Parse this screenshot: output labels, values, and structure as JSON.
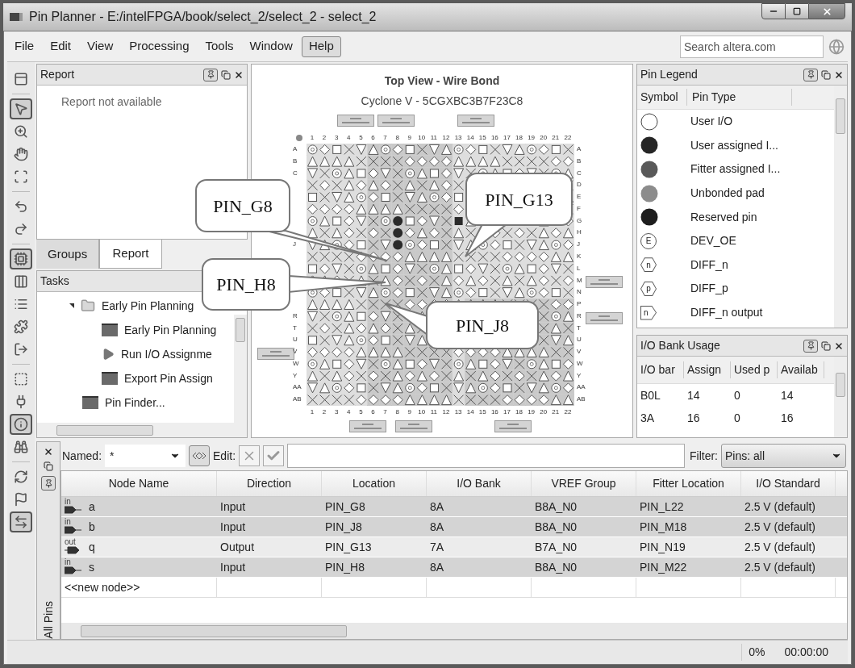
{
  "window": {
    "title": "Pin Planner - E:/intelFPGA/book/select_2/select_2 - select_2"
  },
  "menu": [
    {
      "label": "File",
      "selected": false
    },
    {
      "label": "Edit",
      "selected": false
    },
    {
      "label": "View",
      "selected": false
    },
    {
      "label": "Processing",
      "selected": false
    },
    {
      "label": "Tools",
      "selected": false
    },
    {
      "label": "Window",
      "selected": false
    },
    {
      "label": "Help",
      "selected": true
    }
  ],
  "search": {
    "placeholder": "Search altera.com"
  },
  "left_toolbar": [
    {
      "kind": "layout",
      "selected": false
    },
    {
      "kind": "separator"
    },
    {
      "kind": "pointer",
      "selected": true
    },
    {
      "kind": "zoom",
      "selected": false
    },
    {
      "kind": "hand",
      "selected": false
    },
    {
      "kind": "fit",
      "selected": false
    },
    {
      "kind": "separator"
    },
    {
      "kind": "undo",
      "selected": false
    },
    {
      "kind": "redo",
      "selected": false
    },
    {
      "kind": "separator"
    },
    {
      "kind": "chip",
      "selected": true
    },
    {
      "kind": "columns",
      "selected": false
    },
    {
      "kind": "list",
      "selected": false
    },
    {
      "kind": "puzzle",
      "selected": false
    },
    {
      "kind": "export",
      "selected": false
    },
    {
      "kind": "separator"
    },
    {
      "kind": "dashed",
      "selected": false
    },
    {
      "kind": "plug",
      "selected": false
    },
    {
      "kind": "info",
      "selected": true
    },
    {
      "kind": "binoculars",
      "selected": false
    },
    {
      "kind": "separator"
    },
    {
      "kind": "refresh",
      "selected": false
    },
    {
      "kind": "flag",
      "selected": false
    },
    {
      "kind": "swap",
      "selected": true
    }
  ],
  "report_panel": {
    "title": "Report",
    "message": "Report not available"
  },
  "left_tabs": [
    {
      "label": "Groups",
      "selected": false
    },
    {
      "label": "Report",
      "selected": true
    }
  ],
  "tasks_panel": {
    "title": "Tasks",
    "items": [
      {
        "label": "Early Pin Planning",
        "kind": "folder",
        "expanded": true,
        "children": [
          {
            "label": "Early Pin Planning",
            "kind": "task"
          },
          {
            "label": "Run I/O Assignme",
            "kind": "run"
          },
          {
            "label": "Export Pin Assign",
            "kind": "task"
          }
        ]
      },
      {
        "label": "Pin Finder...",
        "kind": "task"
      }
    ]
  },
  "package_view": {
    "title": "Top View - Wire Bond",
    "subtitle": "Cyclone V - 5CGXBC3B7F23C8",
    "top_column_labels": [
      "1",
      "2",
      "3",
      "4",
      "5",
      "6",
      "7",
      "8",
      "9",
      "10",
      "11",
      "12",
      "13",
      "14",
      "15",
      "16",
      "17",
      "18",
      "19",
      "20",
      "21",
      "22"
    ],
    "bottom_column_labels": [
      "1",
      "2",
      "3",
      "4",
      "5",
      "6",
      "7",
      "8",
      "9",
      "10",
      "11",
      "12",
      "13",
      "14",
      "15",
      "16",
      "17",
      "18",
      "19",
      "20",
      "21",
      "22"
    ],
    "left_row_labels": [
      "A",
      "B",
      "C",
      "J",
      "R",
      "T",
      "U",
      "V",
      "W",
      "Y",
      "AA",
      "AB"
    ],
    "right_row_labels": [
      "A",
      "B",
      "C",
      "D",
      "E",
      "F",
      "G",
      "H",
      "J",
      "K",
      "L",
      "M",
      "N",
      "P",
      "R",
      "T",
      "U",
      "V",
      "W",
      "Y",
      "AA",
      "AB"
    ],
    "callouts": [
      {
        "label": "PIN_G8"
      },
      {
        "label": "PIN_G13"
      },
      {
        "label": "PIN_H8"
      },
      {
        "label": "PIN_J8"
      }
    ]
  },
  "pin_legend": {
    "title": "Pin Legend",
    "columns": [
      "Symbol",
      "Pin Type"
    ],
    "rows": [
      {
        "kind": "hollow",
        "label": "User I/O"
      },
      {
        "kind": "filled",
        "color": "#262626",
        "label": "User assigned I..."
      },
      {
        "kind": "filled",
        "color": "#595959",
        "label": "Fitter assigned I..."
      },
      {
        "kind": "filled",
        "color": "#8c8c8c",
        "label": "Unbonded pad"
      },
      {
        "kind": "filled",
        "color": "#1e1e1e",
        "label": "Reserved pin"
      },
      {
        "kind": "circle",
        "glyph": "E",
        "label": "DEV_OE"
      },
      {
        "kind": "hexagon",
        "glyph": "n",
        "label": "DIFF_n"
      },
      {
        "kind": "hexagon",
        "glyph": "p",
        "label": "DIFF_p"
      },
      {
        "kind": "pentagon",
        "glyph": "n",
        "label": "DIFF_n output"
      }
    ]
  },
  "bank_usage": {
    "title": "I/O Bank Usage",
    "columns": [
      "I/O bar",
      "Assign",
      "Used p",
      "Availab"
    ],
    "rows": [
      [
        "B0L",
        "14",
        "0",
        "14"
      ],
      [
        "3A",
        "16",
        "0",
        "16"
      ]
    ]
  },
  "node_filter": {
    "named_label": "Named:",
    "named_value": "*",
    "edit_label": "Edit:",
    "filter_label": "Filter:",
    "filter_value": "Pins: all"
  },
  "side_tab": "All Pins",
  "pins_table": {
    "columns": [
      "Node Name",
      "Direction",
      "Location",
      "I/O Bank",
      "VREF Group",
      "Fitter Location",
      "I/O Standard"
    ],
    "rows": [
      {
        "kind": "in",
        "badge": "in",
        "cells": [
          "a",
          "Input",
          "PIN_G8",
          "8A",
          "B8A_N0",
          "PIN_L22",
          "2.5 V (default)"
        ]
      },
      {
        "kind": "in",
        "badge": "in",
        "cells": [
          "b",
          "Input",
          "PIN_J8",
          "8A",
          "B8A_N0",
          "PIN_M18",
          "2.5 V (default)"
        ]
      },
      {
        "kind": "out",
        "badge": "out",
        "cells": [
          "q",
          "Output",
          "PIN_G13",
          "7A",
          "B7A_N0",
          "PIN_N19",
          "2.5 V (default)"
        ]
      },
      {
        "kind": "in",
        "badge": "in",
        "cells": [
          "s",
          "Input",
          "PIN_H8",
          "8A",
          "B8A_N0",
          "PIN_M22",
          "2.5 V (default)"
        ]
      }
    ],
    "new_node": "<<new node>>"
  },
  "status": {
    "progress": "0%",
    "time": "00:00:00"
  }
}
